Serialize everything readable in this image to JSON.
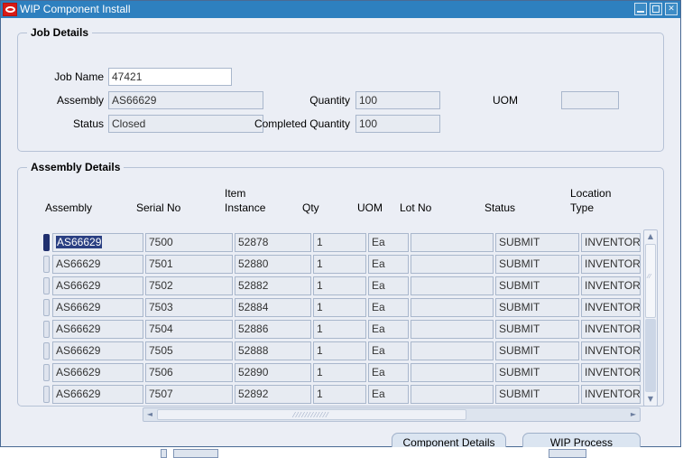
{
  "window": {
    "title": "WIP Component Install",
    "icon": "oracle-logo-icon",
    "minimize_label": "_",
    "maximize_label": "□",
    "close_label": "✕",
    "titlebar_color": "#2e80bf",
    "background_color": "#ebeef5"
  },
  "job_details": {
    "legend": "Job Details",
    "fields": {
      "job_name": {
        "label": "Job Name",
        "value": "47421",
        "editable": true
      },
      "assembly": {
        "label": "Assembly",
        "value": "AS66629",
        "editable": false
      },
      "status": {
        "label": "Status",
        "value": "Closed",
        "editable": false
      },
      "quantity": {
        "label": "Quantity",
        "value": "100",
        "editable": false
      },
      "completed_quantity": {
        "label": "Completed Quantity",
        "value": "100",
        "editable": false
      },
      "uom": {
        "label": "UOM",
        "value": "",
        "editable": false
      }
    }
  },
  "assembly_details": {
    "legend": "Assembly Details",
    "columns": [
      {
        "line1": "",
        "line2": "Assembly"
      },
      {
        "line1": "",
        "line2": "Serial No"
      },
      {
        "line1": "Item",
        "line2": "Instance"
      },
      {
        "line1": "",
        "line2": "Qty"
      },
      {
        "line1": "",
        "line2": "UOM"
      },
      {
        "line1": "",
        "line2": "Lot No"
      },
      {
        "line1": "",
        "line2": "Status"
      },
      {
        "line1": "Location",
        "line2": "Type"
      }
    ],
    "rows": [
      {
        "assembly": "AS66629",
        "serial_no": "7500",
        "item_instance": "52878",
        "qty": "1",
        "uom": "Ea",
        "lot_no": "",
        "status": "SUBMIT",
        "location_type": "INVENTOR",
        "selected": true
      },
      {
        "assembly": "AS66629",
        "serial_no": "7501",
        "item_instance": "52880",
        "qty": "1",
        "uom": "Ea",
        "lot_no": "",
        "status": "SUBMIT",
        "location_type": "INVENTOR",
        "selected": false
      },
      {
        "assembly": "AS66629",
        "serial_no": "7502",
        "item_instance": "52882",
        "qty": "1",
        "uom": "Ea",
        "lot_no": "",
        "status": "SUBMIT",
        "location_type": "INVENTOR",
        "selected": false
      },
      {
        "assembly": "AS66629",
        "serial_no": "7503",
        "item_instance": "52884",
        "qty": "1",
        "uom": "Ea",
        "lot_no": "",
        "status": "SUBMIT",
        "location_type": "INVENTOR",
        "selected": false
      },
      {
        "assembly": "AS66629",
        "serial_no": "7504",
        "item_instance": "52886",
        "qty": "1",
        "uom": "Ea",
        "lot_no": "",
        "status": "SUBMIT",
        "location_type": "INVENTOR",
        "selected": false
      },
      {
        "assembly": "AS66629",
        "serial_no": "7505",
        "item_instance": "52888",
        "qty": "1",
        "uom": "Ea",
        "lot_no": "",
        "status": "SUBMIT",
        "location_type": "INVENTOR",
        "selected": false
      },
      {
        "assembly": "AS66629",
        "serial_no": "7506",
        "item_instance": "52890",
        "qty": "1",
        "uom": "Ea",
        "lot_no": "",
        "status": "SUBMIT",
        "location_type": "INVENTOR",
        "selected": false
      },
      {
        "assembly": "AS66629",
        "serial_no": "7507",
        "item_instance": "52892",
        "qty": "1",
        "uom": "Ea",
        "lot_no": "",
        "status": "SUBMIT",
        "location_type": "INVENTOR",
        "selected": false
      }
    ],
    "scrollbars": {
      "vertical": {
        "up_arrow": "▲",
        "down_arrow": "▼",
        "grip": "⁄⁄"
      },
      "horizontal": {
        "left_arrow": "◄",
        "right_arrow": "►",
        "grip": "⁄⁄⁄⁄⁄⁄⁄⁄⁄⁄⁄⁄"
      }
    }
  },
  "buttons": {
    "component_details": {
      "mnemonic": "C",
      "rest": "omponent Details"
    },
    "wip_process": {
      "label": "WIP Process"
    }
  }
}
